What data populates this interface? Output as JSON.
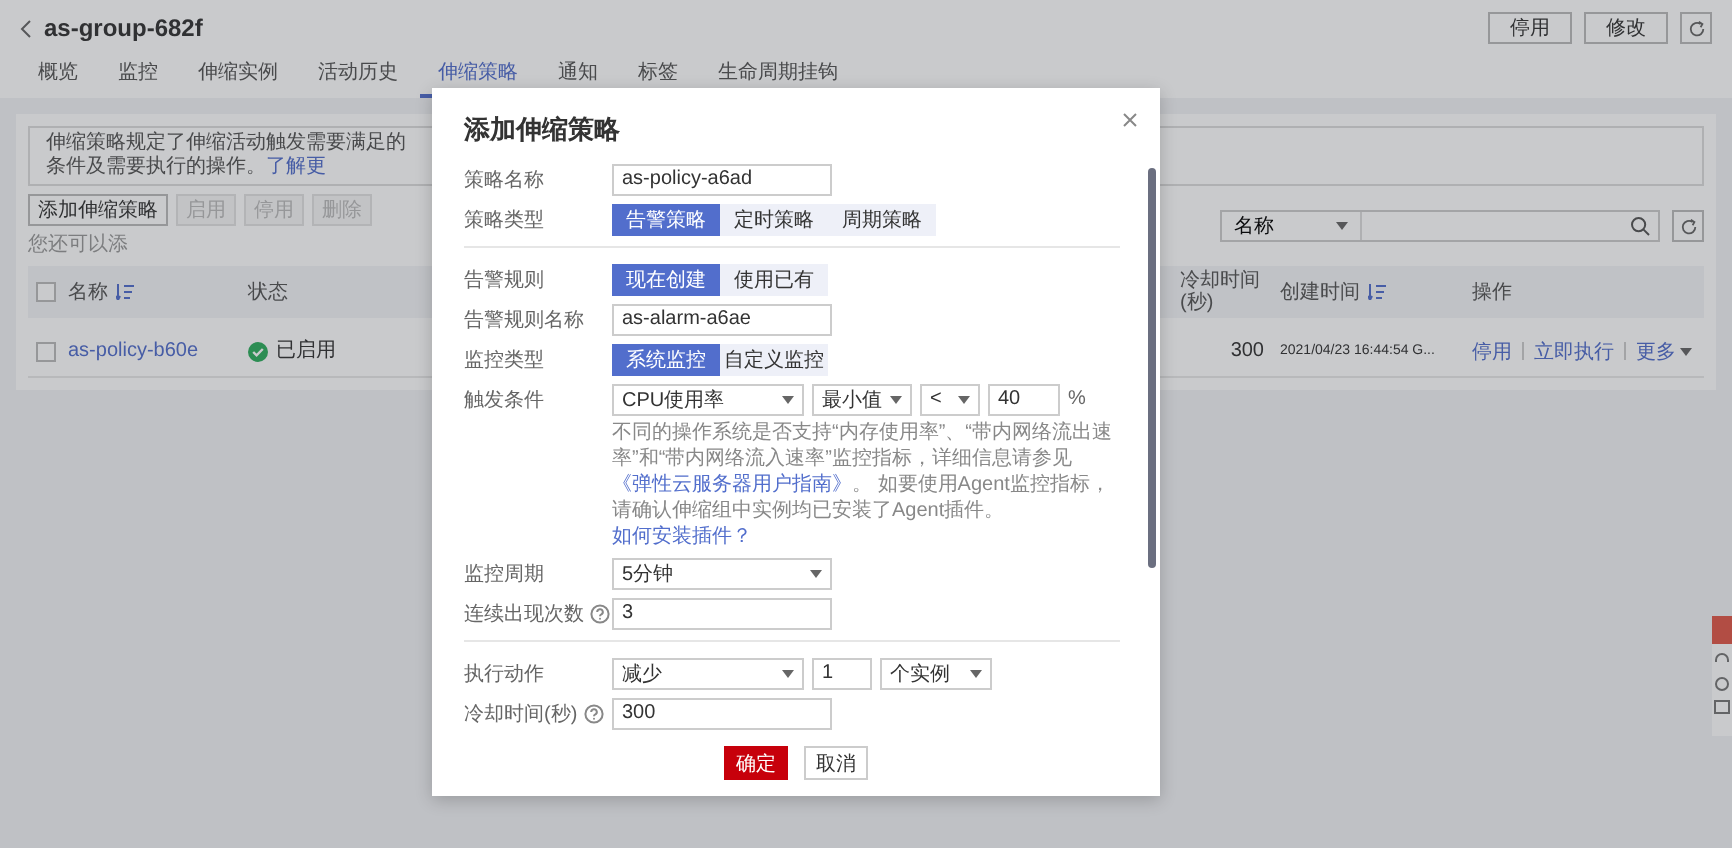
{
  "header": {
    "title": "as-group-682f",
    "buttons": [
      "停用",
      "修改"
    ]
  },
  "tabs": [
    {
      "label": "概览",
      "selected": false
    },
    {
      "label": "监控",
      "selected": false
    },
    {
      "label": "伸缩实例",
      "selected": false
    },
    {
      "label": "活动历史",
      "selected": false
    },
    {
      "label": "伸缩策略",
      "selected": true
    },
    {
      "label": "通知",
      "selected": false
    },
    {
      "label": "标签",
      "selected": false
    },
    {
      "label": "生命周期挂钩",
      "selected": false
    }
  ],
  "policy_panel": {
    "notice": {
      "text": "伸缩策略规定了伸缩活动触发需要满足的条件及需要执行的操作。",
      "link": "了解更"
    },
    "toolbar": {
      "buttons": [
        {
          "label": "添加伸缩策略",
          "disabled": false
        },
        {
          "label": "启用",
          "disabled": true
        },
        {
          "label": "停用",
          "disabled": true
        },
        {
          "label": "删除",
          "disabled": true
        }
      ],
      "hint": "您还可以添"
    },
    "search": {
      "field": "名称"
    },
    "table": {
      "select_all": {
        "checked": false
      },
      "columns": [
        "名称",
        "状态",
        "冷却时间(秒)",
        "创建时间",
        "操作"
      ],
      "rows": [
        {
          "checked": false,
          "name": "as-policy-b60e",
          "status": "已启用",
          "cooldown": "300",
          "created": "2021/04/23 16:44:54 G...",
          "actions": [
            "停用",
            "立即执行",
            "更多"
          ]
        }
      ]
    }
  },
  "dialog": {
    "title": "添加伸缩策略",
    "sections": [
      [
        {
          "kind": "text",
          "label": "策略名称",
          "value": "as-policy-a6ad"
        },
        {
          "kind": "segmented",
          "label": "策略类型",
          "options": [
            {
              "label": "告警策略",
              "selected": true
            },
            {
              "label": "定时策略",
              "selected": false
            },
            {
              "label": "周期策略",
              "selected": false
            }
          ]
        }
      ],
      [
        {
          "kind": "segmented",
          "label": "告警规则",
          "options": [
            {
              "label": "现在创建",
              "selected": true
            },
            {
              "label": "使用已有",
              "selected": false
            }
          ]
        },
        {
          "kind": "text",
          "label": "告警规则名称",
          "value": "as-alarm-a6ae"
        },
        {
          "kind": "segmented",
          "label": "监控类型",
          "options": [
            {
              "label": "系统监控",
              "selected": true
            },
            {
              "label": "自定义监控",
              "selected": false
            }
          ]
        },
        {
          "kind": "condition",
          "label": "触发条件",
          "metric": "CPU使用率",
          "aggregate": "最小值",
          "operator": "<",
          "value": "40",
          "unit": "%"
        },
        {
          "kind": "note",
          "parts": [
            {
              "text": "不同的操作系统是否支持“内存使用率”、“带内网络流出速率”和“带内网络流入速率”监控指标，详细信息请参见",
              "link": false
            },
            {
              "text": "《弹性云服务器用户指南》",
              "link": true
            },
            {
              "text": "。 如要使用Agent监控指标，请确认伸缩组中实例均已安装了Agent插件。",
              "link": false
            },
            {
              "text": "如何安装插件？",
              "link": true
            }
          ]
        },
        {
          "kind": "select",
          "label": "监控周期",
          "value": "5分钟"
        },
        {
          "kind": "text",
          "label": "连续出现次数",
          "value": "3",
          "help": true
        }
      ],
      [
        {
          "kind": "action",
          "label": "执行动作",
          "operation": "减少",
          "count": "1",
          "unit": "个实例"
        },
        {
          "kind": "text",
          "label": "冷却时间(秒)",
          "value": "300",
          "help": true
        }
      ]
    ],
    "buttons": [
      {
        "label": "确定",
        "kind": "primary"
      },
      {
        "label": "取消",
        "kind": "default"
      }
    ]
  }
}
